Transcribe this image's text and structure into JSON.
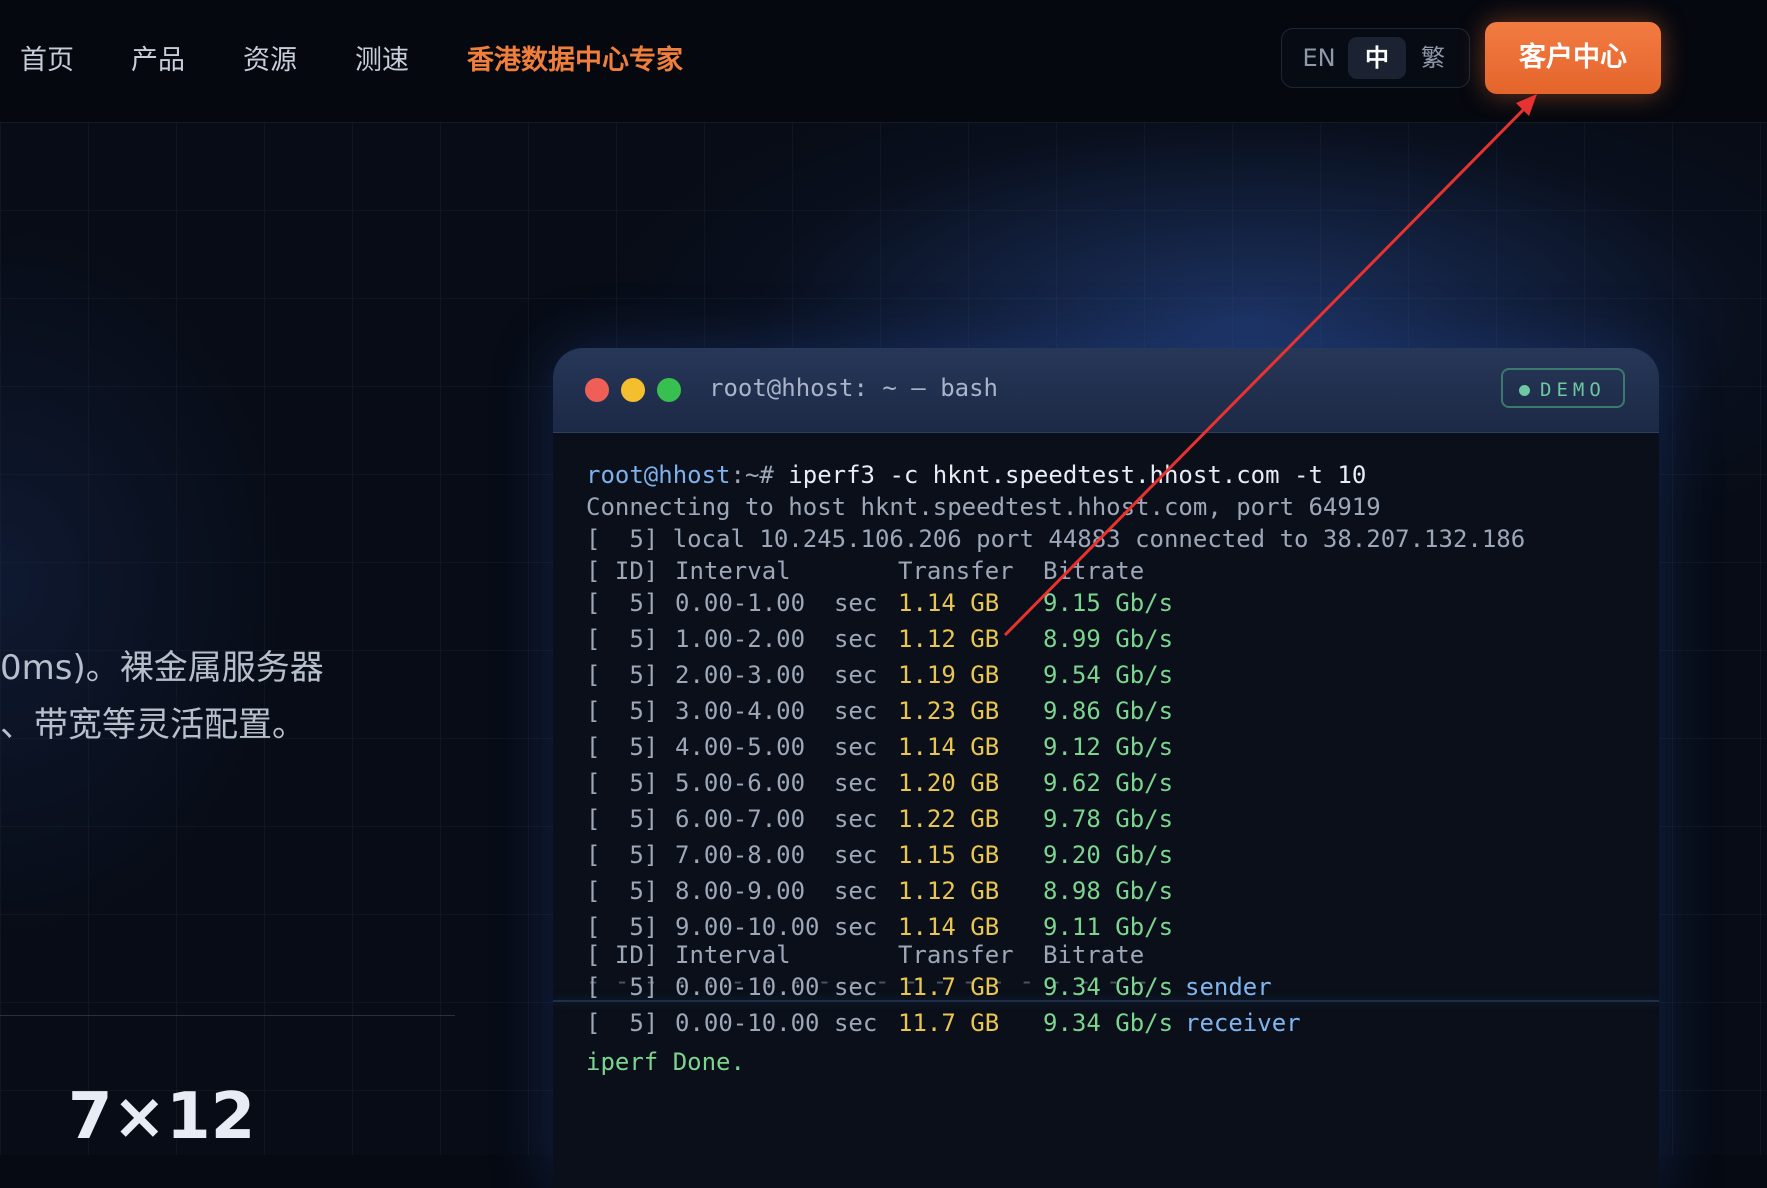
{
  "nav": {
    "items": [
      "首页",
      "产品",
      "资源",
      "测速"
    ],
    "brand_link": "香港数据中心专家",
    "languages": [
      "EN",
      "中",
      "繁"
    ],
    "active_language": "中",
    "cta": "客户中心"
  },
  "hero": {
    "line1": "0ms)。裸金属服务器",
    "line2": "、带宽等灵活配置。",
    "stat": "7×12"
  },
  "terminal": {
    "title": "root@hhost: ~ — bash",
    "badge": "DEMO",
    "prompt": "root@hhost",
    "prompt_suffix": ":~# ",
    "command": "iperf3 -c hknt.speedtest.hhost.com -t 10",
    "connecting": "Connecting to host hknt.speedtest.hhost.com, port 64919",
    "local": "[  5] local 10.245.106.206 port 44883 connected to 38.207.132.186",
    "header": {
      "id": "[ ID]",
      "interval": "Interval",
      "transfer": "Transfer",
      "bitrate": "Bitrate"
    },
    "rows": [
      {
        "id": "[  5]",
        "interval": "0.00-1.00  sec",
        "transfer": "1.14 GB",
        "bitrate": "9.15 Gb/s"
      },
      {
        "id": "[  5]",
        "interval": "1.00-2.00  sec",
        "transfer": "1.12 GB",
        "bitrate": "8.99 Gb/s"
      },
      {
        "id": "[  5]",
        "interval": "2.00-3.00  sec",
        "transfer": "1.19 GB",
        "bitrate": "9.54 Gb/s"
      },
      {
        "id": "[  5]",
        "interval": "3.00-4.00  sec",
        "transfer": "1.23 GB",
        "bitrate": "9.86 Gb/s"
      },
      {
        "id": "[  5]",
        "interval": "4.00-5.00  sec",
        "transfer": "1.14 GB",
        "bitrate": "9.12 Gb/s"
      },
      {
        "id": "[  5]",
        "interval": "5.00-6.00  sec",
        "transfer": "1.20 GB",
        "bitrate": "9.62 Gb/s"
      },
      {
        "id": "[  5]",
        "interval": "6.00-7.00  sec",
        "transfer": "1.22 GB",
        "bitrate": "9.78 Gb/s"
      },
      {
        "id": "[  5]",
        "interval": "7.00-8.00  sec",
        "transfer": "1.15 GB",
        "bitrate": "9.20 Gb/s"
      },
      {
        "id": "[  5]",
        "interval": "8.00-9.00  sec",
        "transfer": "1.12 GB",
        "bitrate": "8.98 Gb/s"
      },
      {
        "id": "[  5]",
        "interval": "9.00-10.00 sec",
        "transfer": "1.14 GB",
        "bitrate": "9.11 Gb/s"
      }
    ],
    "separator": "- - - - - - - - - - - - - - - - - - - -",
    "summary": [
      {
        "id": "[  5]",
        "interval": "0.00-10.00 sec",
        "transfer": "11.7 GB",
        "bitrate": "9.34 Gb/s",
        "role": "sender"
      },
      {
        "id": "[  5]",
        "interval": "0.00-10.00 sec",
        "transfer": "11.7 GB",
        "bitrate": "9.34 Gb/s",
        "role": "receiver"
      }
    ],
    "done": "iperf Done."
  },
  "colors": {
    "accent": "#ef7f3b",
    "terminal_green": "#7cd58f",
    "terminal_yellow": "#e9c552",
    "annotation_arrow": "#e8322f"
  }
}
